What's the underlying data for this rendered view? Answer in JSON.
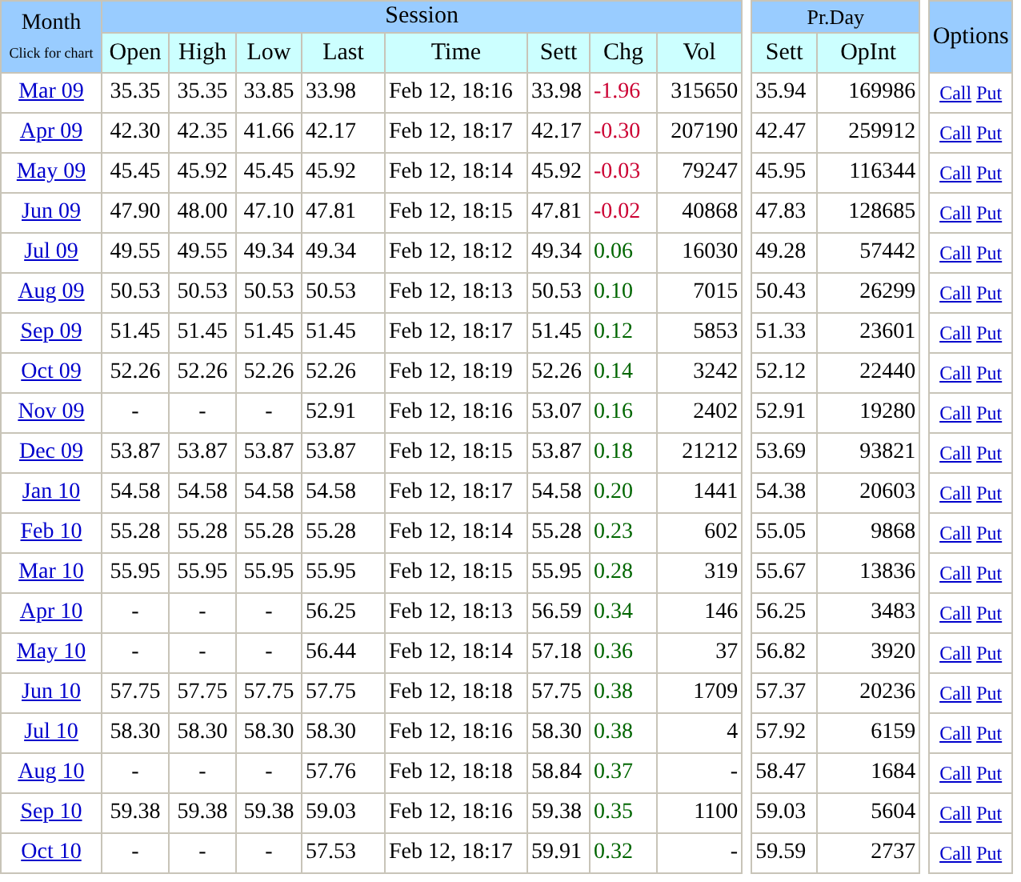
{
  "month_header": {
    "title": "Month",
    "subtitle": "Click for chart"
  },
  "session": {
    "title": "Session",
    "columns": [
      "Open",
      "High",
      "Low",
      "Last",
      "Time",
      "Sett",
      "Chg",
      "Vol"
    ]
  },
  "prior_day": {
    "title": "Pr.Day",
    "columns": [
      "Sett",
      "OpInt"
    ]
  },
  "options_header": "Options",
  "rows": [
    {
      "month": "Mar 09",
      "open": "35.35",
      "high": "35.35",
      "low": "33.85",
      "last": "33.98",
      "time": "Feb 12, 18:16",
      "sett": "33.98",
      "chg": "-1.96",
      "negative": true,
      "vol": "315650",
      "prev_sett": "35.94",
      "opint": "169986",
      "call": "Call",
      "put": "Put"
    },
    {
      "month": "Apr 09",
      "open": "42.30",
      "high": "42.35",
      "low": "41.66",
      "last": "42.17",
      "time": "Feb 12, 18:17",
      "sett": "42.17",
      "chg": "-0.30",
      "negative": true,
      "vol": "207190",
      "prev_sett": "42.47",
      "opint": "259912",
      "call": "Call",
      "put": "Put"
    },
    {
      "month": "May 09",
      "open": "45.45",
      "high": "45.92",
      "low": "45.45",
      "last": "45.92",
      "time": "Feb 12, 18:14",
      "sett": "45.92",
      "chg": "-0.03",
      "negative": true,
      "vol": "79247",
      "prev_sett": "45.95",
      "opint": "116344",
      "call": "Call",
      "put": "Put"
    },
    {
      "month": "Jun 09",
      "open": "47.90",
      "high": "48.00",
      "low": "47.10",
      "last": "47.81",
      "time": "Feb 12, 18:15",
      "sett": "47.81",
      "chg": "-0.02",
      "negative": true,
      "vol": "40868",
      "prev_sett": "47.83",
      "opint": "128685",
      "call": "Call",
      "put": "Put"
    },
    {
      "month": "Jul 09",
      "open": "49.55",
      "high": "49.55",
      "low": "49.34",
      "last": "49.34",
      "time": "Feb 12, 18:12",
      "sett": "49.34",
      "chg": "0.06",
      "negative": false,
      "vol": "16030",
      "prev_sett": "49.28",
      "opint": "57442",
      "call": "Call",
      "put": "Put"
    },
    {
      "month": "Aug 09",
      "open": "50.53",
      "high": "50.53",
      "low": "50.53",
      "last": "50.53",
      "time": "Feb 12, 18:13",
      "sett": "50.53",
      "chg": "0.10",
      "negative": false,
      "vol": "7015",
      "prev_sett": "50.43",
      "opint": "26299",
      "call": "Call",
      "put": "Put"
    },
    {
      "month": "Sep 09",
      "open": "51.45",
      "high": "51.45",
      "low": "51.45",
      "last": "51.45",
      "time": "Feb 12, 18:17",
      "sett": "51.45",
      "chg": "0.12",
      "negative": false,
      "vol": "5853",
      "prev_sett": "51.33",
      "opint": "23601",
      "call": "Call",
      "put": "Put"
    },
    {
      "month": "Oct 09",
      "open": "52.26",
      "high": "52.26",
      "low": "52.26",
      "last": "52.26",
      "time": "Feb 12, 18:19",
      "sett": "52.26",
      "chg": "0.14",
      "negative": false,
      "vol": "3242",
      "prev_sett": "52.12",
      "opint": "22440",
      "call": "Call",
      "put": "Put"
    },
    {
      "month": "Nov 09",
      "open": "-",
      "high": "-",
      "low": "-",
      "last": "52.91",
      "time": "Feb 12, 18:16",
      "sett": "53.07",
      "chg": "0.16",
      "negative": false,
      "vol": "2402",
      "prev_sett": "52.91",
      "opint": "19280",
      "call": "Call",
      "put": "Put"
    },
    {
      "month": "Dec 09",
      "open": "53.87",
      "high": "53.87",
      "low": "53.87",
      "last": "53.87",
      "time": "Feb 12, 18:15",
      "sett": "53.87",
      "chg": "0.18",
      "negative": false,
      "vol": "21212",
      "prev_sett": "53.69",
      "opint": "93821",
      "call": "Call",
      "put": "Put"
    },
    {
      "month": "Jan 10",
      "open": "54.58",
      "high": "54.58",
      "low": "54.58",
      "last": "54.58",
      "time": "Feb 12, 18:17",
      "sett": "54.58",
      "chg": "0.20",
      "negative": false,
      "vol": "1441",
      "prev_sett": "54.38",
      "opint": "20603",
      "call": "Call",
      "put": "Put"
    },
    {
      "month": "Feb 10",
      "open": "55.28",
      "high": "55.28",
      "low": "55.28",
      "last": "55.28",
      "time": "Feb 12, 18:14",
      "sett": "55.28",
      "chg": "0.23",
      "negative": false,
      "vol": "602",
      "prev_sett": "55.05",
      "opint": "9868",
      "call": "Call",
      "put": "Put"
    },
    {
      "month": "Mar 10",
      "open": "55.95",
      "high": "55.95",
      "low": "55.95",
      "last": "55.95",
      "time": "Feb 12, 18:15",
      "sett": "55.95",
      "chg": "0.28",
      "negative": false,
      "vol": "319",
      "prev_sett": "55.67",
      "opint": "13836",
      "call": "Call",
      "put": "Put"
    },
    {
      "month": "Apr 10",
      "open": "-",
      "high": "-",
      "low": "-",
      "last": "56.25",
      "time": "Feb 12, 18:13",
      "sett": "56.59",
      "chg": "0.34",
      "negative": false,
      "vol": "146",
      "prev_sett": "56.25",
      "opint": "3483",
      "call": "Call",
      "put": "Put"
    },
    {
      "month": "May 10",
      "open": "-",
      "high": "-",
      "low": "-",
      "last": "56.44",
      "time": "Feb 12, 18:14",
      "sett": "57.18",
      "chg": "0.36",
      "negative": false,
      "vol": "37",
      "prev_sett": "56.82",
      "opint": "3920",
      "call": "Call",
      "put": "Put"
    },
    {
      "month": "Jun 10",
      "open": "57.75",
      "high": "57.75",
      "low": "57.75",
      "last": "57.75",
      "time": "Feb 12, 18:18",
      "sett": "57.75",
      "chg": "0.38",
      "negative": false,
      "vol": "1709",
      "prev_sett": "57.37",
      "opint": "20236",
      "call": "Call",
      "put": "Put"
    },
    {
      "month": "Jul 10",
      "open": "58.30",
      "high": "58.30",
      "low": "58.30",
      "last": "58.30",
      "time": "Feb 12, 18:16",
      "sett": "58.30",
      "chg": "0.38",
      "negative": false,
      "vol": "4",
      "prev_sett": "57.92",
      "opint": "6159",
      "call": "Call",
      "put": "Put"
    },
    {
      "month": "Aug 10",
      "open": "-",
      "high": "-",
      "low": "-",
      "last": "57.76",
      "time": "Feb 12, 18:18",
      "sett": "58.84",
      "chg": "0.37",
      "negative": false,
      "vol": "-",
      "prev_sett": "58.47",
      "opint": "1684",
      "call": "Call",
      "put": "Put"
    },
    {
      "month": "Sep 10",
      "open": "59.38",
      "high": "59.38",
      "low": "59.38",
      "last": "59.03",
      "time": "Feb 12, 18:16",
      "sett": "59.38",
      "chg": "0.35",
      "negative": false,
      "vol": "1100",
      "prev_sett": "59.03",
      "opint": "5604",
      "call": "Call",
      "put": "Put"
    },
    {
      "month": "Oct 10",
      "open": "-",
      "high": "-",
      "low": "-",
      "last": "57.53",
      "time": "Feb 12, 18:17",
      "sett": "59.91",
      "chg": "0.32",
      "negative": false,
      "vol": "-",
      "prev_sett": "59.59",
      "opint": "2737",
      "call": "Call",
      "put": "Put"
    }
  ]
}
